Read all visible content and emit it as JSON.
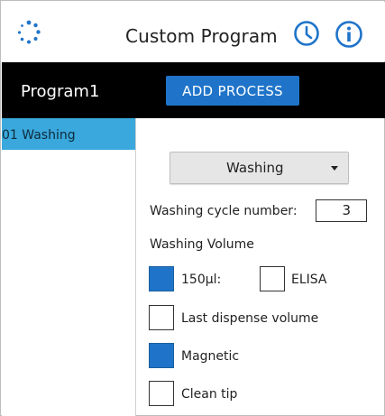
{
  "header": {
    "title": "Custom Program",
    "icons": [
      "app-logo-icon",
      "history-clock-icon",
      "info-icon"
    ],
    "accent_color": "#1f74c9"
  },
  "program_bar": {
    "program_name": "Program1",
    "add_process_label": "ADD PROCESS"
  },
  "sidebar": {
    "items": [
      {
        "label": "01 Washing",
        "selected": true
      }
    ],
    "selected_color": "#3aa8dc"
  },
  "process": {
    "selected_type": "Washing",
    "cycle_label": "Washing cycle number:",
    "cycle_value": "3",
    "volume_label": "Washing Volume",
    "options": {
      "volume_150": {
        "label": "150µl:",
        "checked": true
      },
      "elisa": {
        "label": "ELISA",
        "checked": false
      },
      "last_dispense": {
        "label": "Last dispense volume",
        "checked": false
      },
      "magnetic": {
        "label": "Magnetic",
        "checked": true
      },
      "clean_tip": {
        "label": "Clean tip",
        "checked": false
      }
    }
  }
}
